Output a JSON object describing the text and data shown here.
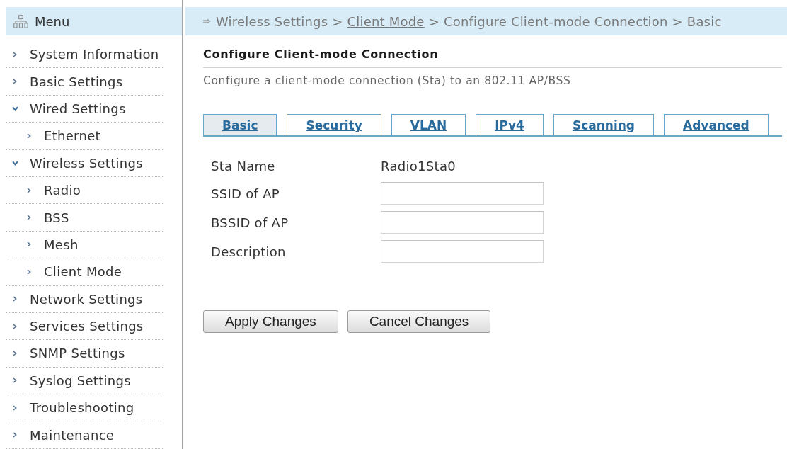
{
  "sidebar": {
    "title": "Menu",
    "items": [
      {
        "label": "System Information",
        "expanded": false
      },
      {
        "label": "Basic Settings",
        "expanded": false
      },
      {
        "label": "Wired Settings",
        "expanded": true,
        "children": [
          {
            "label": "Ethernet",
            "expanded": false
          }
        ]
      },
      {
        "label": "Wireless Settings",
        "expanded": true,
        "children": [
          {
            "label": "Radio",
            "expanded": false
          },
          {
            "label": "BSS",
            "expanded": false
          },
          {
            "label": "Mesh",
            "expanded": false
          },
          {
            "label": "Client Mode",
            "expanded": false
          }
        ]
      },
      {
        "label": "Network Settings",
        "expanded": false
      },
      {
        "label": "Services Settings",
        "expanded": false
      },
      {
        "label": "SNMP Settings",
        "expanded": false
      },
      {
        "label": "Syslog Settings",
        "expanded": false
      },
      {
        "label": "Troubleshooting",
        "expanded": false
      },
      {
        "label": "Maintenance",
        "expanded": false
      }
    ]
  },
  "breadcrumb": [
    {
      "label": "Wireless Settings",
      "kind": "text"
    },
    {
      "label": ">",
      "kind": "separator"
    },
    {
      "label": "Client Mode",
      "kind": "link"
    },
    {
      "label": ">",
      "kind": "separator"
    },
    {
      "label": "Configure Client-mode Connection",
      "kind": "text"
    },
    {
      "label": ">",
      "kind": "separator"
    },
    {
      "label": "Basic",
      "kind": "text"
    }
  ],
  "title": "Configure Client-mode Connection",
  "description": "Configure a client-mode connection (Sta) to an 802.11 AP/BSS",
  "tabs": [
    {
      "label": "Basic",
      "selected": true
    },
    {
      "label": "Security",
      "selected": false
    },
    {
      "label": "VLAN",
      "selected": false
    },
    {
      "label": "IPv4",
      "selected": false
    },
    {
      "label": "Scanning",
      "selected": false
    },
    {
      "label": "Advanced",
      "selected": false
    }
  ],
  "fields": [
    {
      "label": "Sta Name",
      "kind": "text",
      "value": "Radio1Sta0"
    },
    {
      "label": "SSID of AP",
      "kind": "input"
    },
    {
      "label": "BSSID of AP",
      "kind": "input"
    },
    {
      "label": "Description",
      "kind": "input"
    }
  ],
  "buttons": [
    "Apply Changes",
    "Cancel Changes"
  ]
}
